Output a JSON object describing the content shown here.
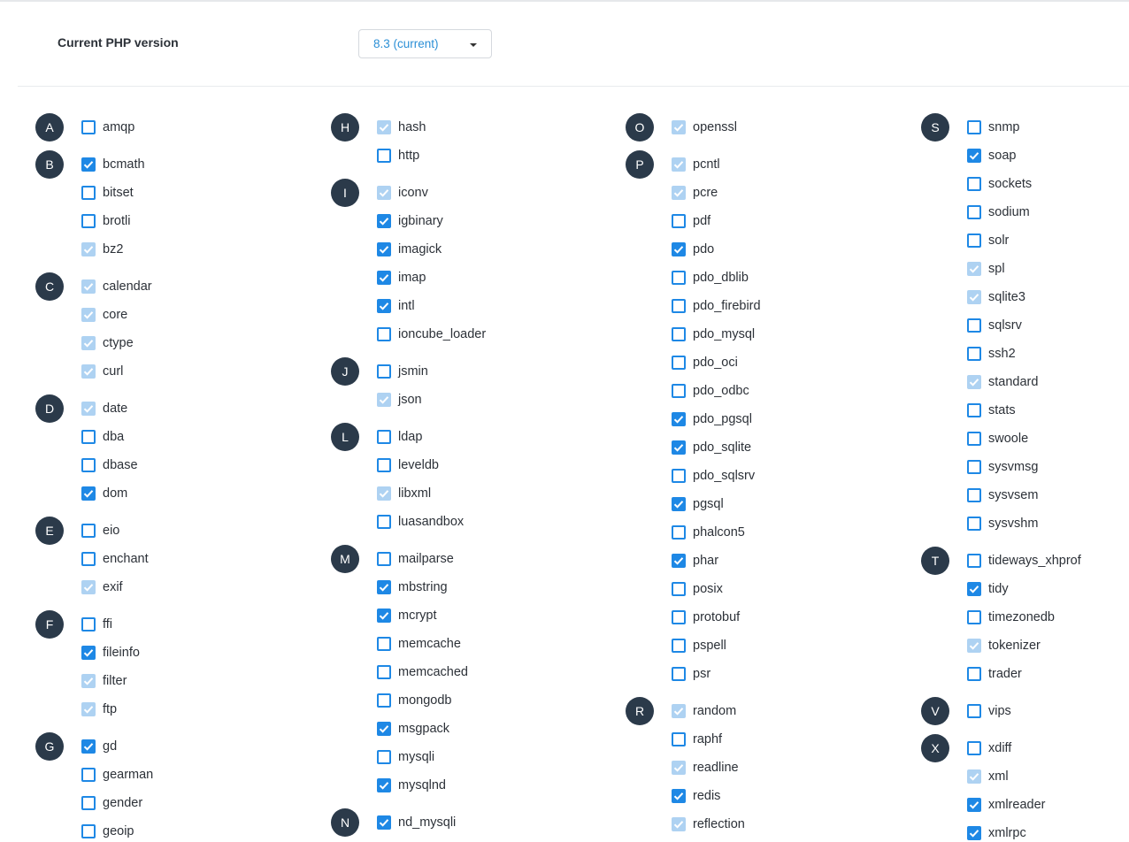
{
  "header": {
    "label": "Current PHP version",
    "version_value": "8.3 (current)"
  },
  "columns": [
    [
      {
        "letter": "A",
        "items": [
          [
            "amqp",
            "off"
          ]
        ]
      },
      {
        "letter": "B",
        "items": [
          [
            "bcmath",
            "on"
          ],
          [
            "bitset",
            "off"
          ],
          [
            "brotli",
            "off"
          ],
          [
            "bz2",
            "dis"
          ]
        ]
      },
      {
        "letter": "C",
        "items": [
          [
            "calendar",
            "dis"
          ],
          [
            "core",
            "dis"
          ],
          [
            "ctype",
            "dis"
          ],
          [
            "curl",
            "dis"
          ]
        ]
      },
      {
        "letter": "D",
        "items": [
          [
            "date",
            "dis"
          ],
          [
            "dba",
            "off"
          ],
          [
            "dbase",
            "off"
          ],
          [
            "dom",
            "on"
          ]
        ]
      },
      {
        "letter": "E",
        "items": [
          [
            "eio",
            "off"
          ],
          [
            "enchant",
            "off"
          ],
          [
            "exif",
            "dis"
          ]
        ]
      },
      {
        "letter": "F",
        "items": [
          [
            "ffi",
            "off"
          ],
          [
            "fileinfo",
            "on"
          ],
          [
            "filter",
            "dis"
          ],
          [
            "ftp",
            "dis"
          ]
        ]
      },
      {
        "letter": "G",
        "items": [
          [
            "gd",
            "on"
          ],
          [
            "gearman",
            "off"
          ],
          [
            "gender",
            "off"
          ],
          [
            "geoip",
            "off"
          ]
        ]
      }
    ],
    [
      {
        "letter": "H",
        "items": [
          [
            "hash",
            "dis"
          ],
          [
            "http",
            "off"
          ]
        ]
      },
      {
        "letter": "I",
        "items": [
          [
            "iconv",
            "dis"
          ],
          [
            "igbinary",
            "on"
          ],
          [
            "imagick",
            "on"
          ],
          [
            "imap",
            "on"
          ],
          [
            "intl",
            "on"
          ],
          [
            "ioncube_loader",
            "off"
          ]
        ]
      },
      {
        "letter": "J",
        "items": [
          [
            "jsmin",
            "off"
          ],
          [
            "json",
            "dis"
          ]
        ]
      },
      {
        "letter": "L",
        "items": [
          [
            "ldap",
            "off"
          ],
          [
            "leveldb",
            "off"
          ],
          [
            "libxml",
            "dis"
          ],
          [
            "luasandbox",
            "off"
          ]
        ]
      },
      {
        "letter": "M",
        "items": [
          [
            "mailparse",
            "off"
          ],
          [
            "mbstring",
            "on"
          ],
          [
            "mcrypt",
            "on"
          ],
          [
            "memcache",
            "off"
          ],
          [
            "memcached",
            "off"
          ],
          [
            "mongodb",
            "off"
          ],
          [
            "msgpack",
            "on"
          ],
          [
            "mysqli",
            "off"
          ],
          [
            "mysqlnd",
            "on"
          ]
        ]
      },
      {
        "letter": "N",
        "items": [
          [
            "nd_mysqli",
            "on"
          ]
        ]
      }
    ],
    [
      {
        "letter": "O",
        "items": [
          [
            "openssl",
            "dis"
          ]
        ]
      },
      {
        "letter": "P",
        "items": [
          [
            "pcntl",
            "dis"
          ],
          [
            "pcre",
            "dis"
          ],
          [
            "pdf",
            "off"
          ],
          [
            "pdo",
            "on"
          ],
          [
            "pdo_dblib",
            "off"
          ],
          [
            "pdo_firebird",
            "off"
          ],
          [
            "pdo_mysql",
            "off"
          ],
          [
            "pdo_oci",
            "off"
          ],
          [
            "pdo_odbc",
            "off"
          ],
          [
            "pdo_pgsql",
            "on"
          ],
          [
            "pdo_sqlite",
            "on"
          ],
          [
            "pdo_sqlsrv",
            "off"
          ],
          [
            "pgsql",
            "on"
          ],
          [
            "phalcon5",
            "off"
          ],
          [
            "phar",
            "on"
          ],
          [
            "posix",
            "off"
          ],
          [
            "protobuf",
            "off"
          ],
          [
            "pspell",
            "off"
          ],
          [
            "psr",
            "off"
          ]
        ]
      },
      {
        "letter": "R",
        "items": [
          [
            "random",
            "dis"
          ],
          [
            "raphf",
            "off"
          ],
          [
            "readline",
            "dis"
          ],
          [
            "redis",
            "on"
          ],
          [
            "reflection",
            "dis"
          ]
        ]
      }
    ],
    [
      {
        "letter": "S",
        "items": [
          [
            "snmp",
            "off"
          ],
          [
            "soap",
            "on"
          ],
          [
            "sockets",
            "off"
          ],
          [
            "sodium",
            "off"
          ],
          [
            "solr",
            "off"
          ],
          [
            "spl",
            "dis"
          ],
          [
            "sqlite3",
            "dis"
          ],
          [
            "sqlsrv",
            "off"
          ],
          [
            "ssh2",
            "off"
          ],
          [
            "standard",
            "dis"
          ],
          [
            "stats",
            "off"
          ],
          [
            "swoole",
            "off"
          ],
          [
            "sysvmsg",
            "off"
          ],
          [
            "sysvsem",
            "off"
          ],
          [
            "sysvshm",
            "off"
          ]
        ]
      },
      {
        "letter": "T",
        "items": [
          [
            "tideways_xhprof",
            "off"
          ],
          [
            "tidy",
            "on"
          ],
          [
            "timezonedb",
            "off"
          ],
          [
            "tokenizer",
            "dis"
          ],
          [
            "trader",
            "off"
          ]
        ]
      },
      {
        "letter": "V",
        "items": [
          [
            "vips",
            "off"
          ]
        ]
      },
      {
        "letter": "X",
        "items": [
          [
            "xdiff",
            "off"
          ],
          [
            "xml",
            "dis"
          ],
          [
            "xmlreader",
            "on"
          ],
          [
            "xmlrpc",
            "on"
          ]
        ]
      }
    ]
  ]
}
